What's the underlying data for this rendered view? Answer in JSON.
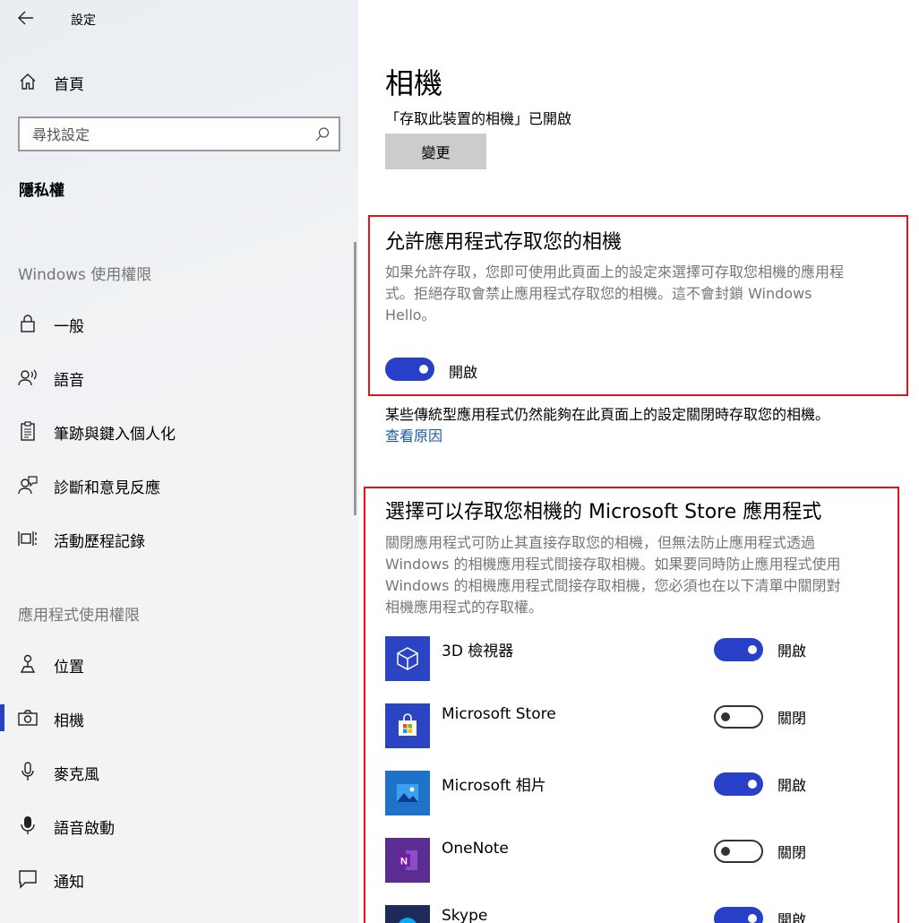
{
  "app": {
    "title": "設定"
  },
  "sidebar": {
    "home_label": "首頁",
    "search_placeholder": "尋找設定",
    "group_title": "隱私權",
    "windows_header": "Windows 使用權限",
    "windows_items": [
      {
        "label": "一般",
        "icon": "lock-icon"
      },
      {
        "label": "語音",
        "icon": "speech-icon"
      },
      {
        "label": "筆跡與鍵入個人化",
        "icon": "clipboard-icon"
      },
      {
        "label": "診斷和意見反應",
        "icon": "feedback-icon"
      },
      {
        "label": "活動歷程記錄",
        "icon": "timeline-icon"
      }
    ],
    "apps_header": "應用程式使用權限",
    "app_items": [
      {
        "label": "位置",
        "icon": "location-icon"
      },
      {
        "label": "相機",
        "icon": "camera-icon",
        "active": true
      },
      {
        "label": "麥克風",
        "icon": "microphone-icon"
      },
      {
        "label": "語音啟動",
        "icon": "voice-activation-icon"
      },
      {
        "label": "通知",
        "icon": "notification-icon"
      }
    ]
  },
  "main": {
    "title": "相機",
    "device_status": "「存取此裝置的相機」已開啟",
    "change_button": "變更",
    "allow_section": {
      "heading": "允許應用程式存取您的相機",
      "desc_line1": "如果允許存取，您即可使用此頁面上的設定來選擇可存取您相機的應用程",
      "desc_line2": "式。拒絕存取會禁止應用程式存取您的相機。這不會封鎖 Windows",
      "desc_line3": "Hello。",
      "toggle_state": "開啟"
    },
    "note": "某些傳統型應用程式仍然能夠在此頁面上的設定關閉時存取您的相機。",
    "note_link": "查看原因",
    "store_section": {
      "heading": "選擇可以存取您相機的 Microsoft Store 應用程式",
      "desc_line1": "關閉應用程式可防止其直接存取您的相機，但無法防止應用程式透過",
      "desc_line2": "Windows 的相機應用程式間接存取相機。如果要同時防止應用程式使用",
      "desc_line3": "Windows 的相機應用程式間接存取相機，您必須也在以下清單中關閉對",
      "desc_line4": "相機應用程式的存取權。",
      "apps": [
        {
          "name": "3D 檢視器",
          "state": "開啟",
          "on": true,
          "icon": "3d-viewer-icon"
        },
        {
          "name": "Microsoft Store",
          "state": "關閉",
          "on": false,
          "icon": "store-bag-icon"
        },
        {
          "name": "Microsoft 相片",
          "state": "開啟",
          "on": true,
          "icon": "photos-icon"
        },
        {
          "name": "OneNote",
          "state": "關閉",
          "on": false,
          "icon": "onenote-icon"
        },
        {
          "name": "Skype",
          "state": "開啟",
          "on": true,
          "icon": "skype-icon"
        }
      ]
    }
  },
  "colors": {
    "accent": "#2840c8",
    "highlight_box": "#e0141e",
    "link": "#1a5aa8"
  }
}
